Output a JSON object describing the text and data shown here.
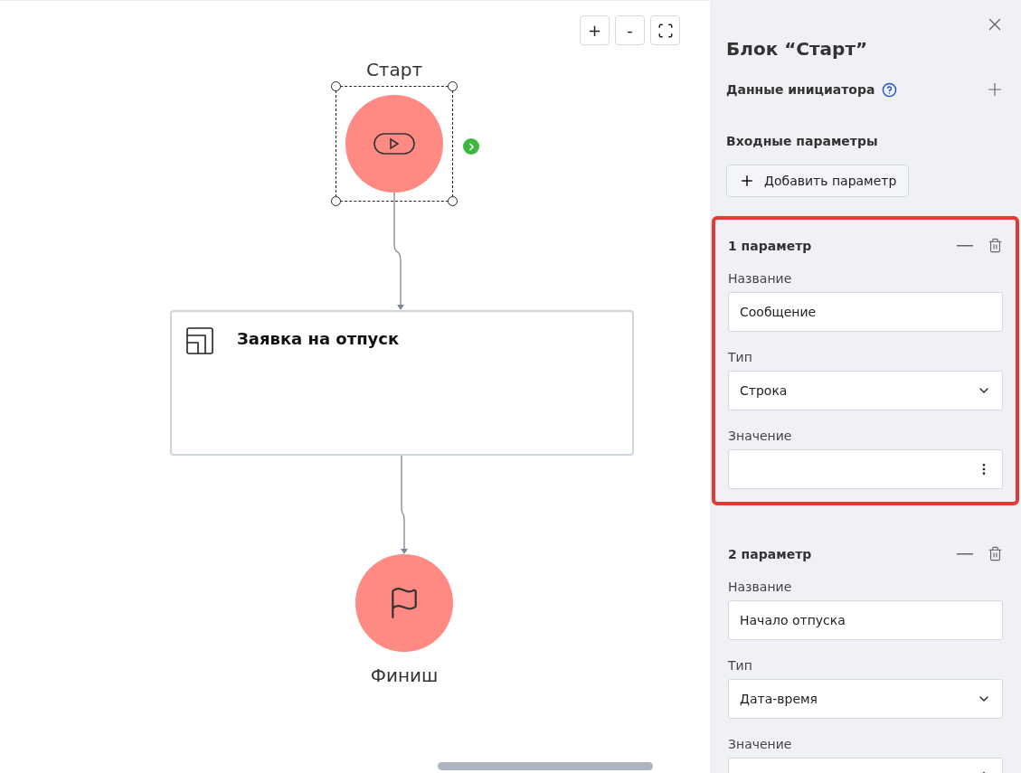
{
  "zoom_controls": [
    {
      "kind": "text",
      "label": "+"
    },
    {
      "kind": "text",
      "label": "-"
    },
    {
      "kind": "fullscreen"
    }
  ],
  "canvas": {
    "start_node": {
      "label": "Старт",
      "selected": true
    },
    "task_node": {
      "title": "Заявка на отпуск"
    },
    "finish_node": {
      "label": "Финиш"
    }
  },
  "panel": {
    "title": "Блок “Старт”",
    "initiator_section": "Данные инициатора",
    "input_section": "Входные параметры",
    "add_button": "Добавить параметр",
    "params": [
      {
        "title": "1 параметр",
        "selected": true,
        "fields": [
          {
            "kind": "input",
            "label": "Название",
            "value": "Сообщение"
          },
          {
            "kind": "select",
            "label": "Тип",
            "value": "Строка"
          },
          {
            "kind": "menu",
            "label": "Значение"
          }
        ]
      },
      {
        "title": "2 параметр",
        "selected": false,
        "fields": [
          {
            "kind": "input",
            "label": "Название",
            "value": "Начало отпуска"
          },
          {
            "kind": "select",
            "label": "Тип",
            "value": "Дата-время"
          },
          {
            "kind": "menu",
            "label": "Значение"
          }
        ]
      }
    ]
  }
}
